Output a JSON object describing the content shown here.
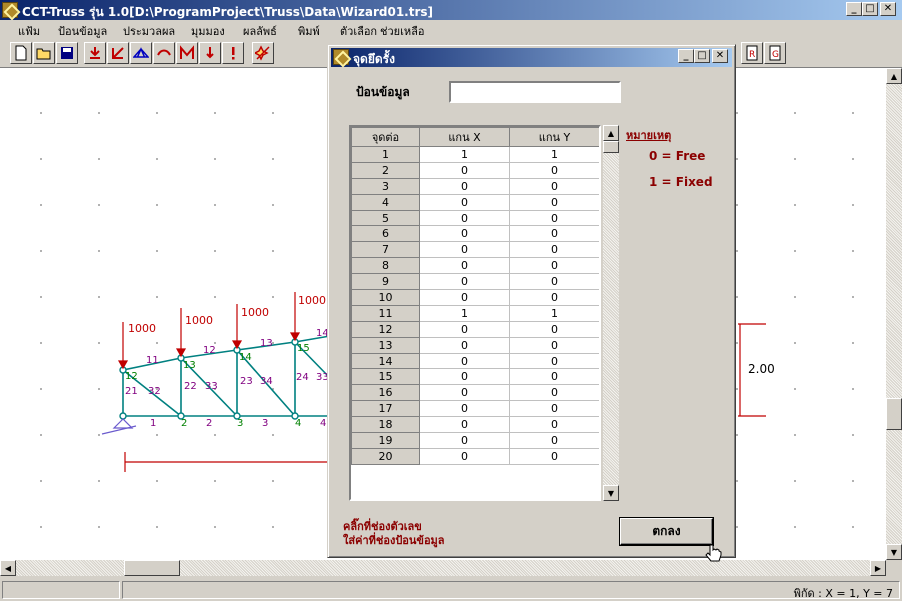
{
  "window": {
    "title": "CCT-Truss รุ่น 1.0[D:\\ProgramProject\\Truss\\Data\\Wizard01.trs]"
  },
  "menu": [
    {
      "label": "แฟ้ม"
    },
    {
      "label": "ป้อนข้อมูล"
    },
    {
      "label": "ประมวลผล"
    },
    {
      "label": "มุมมอง"
    },
    {
      "label": "ผลลัพธ์"
    },
    {
      "label": "พิมพ์"
    },
    {
      "label": "ตัวเลือก"
    },
    {
      "label": "ช่วยเหลือ"
    }
  ],
  "drawing": {
    "loads": [
      "1000",
      "1000",
      "1000",
      "1000"
    ],
    "top_members": [
      "11",
      "12",
      "13"
    ],
    "nodes": [
      "12",
      "13",
      "14",
      "15"
    ],
    "diagonals": [
      "21",
      "32",
      "22",
      "33",
      "23",
      "34",
      "24",
      "33"
    ],
    "bottom_labels": [
      "1",
      "2",
      "2",
      "3",
      "3",
      "4",
      "4"
    ],
    "partial_label": "14",
    "dimension": "2.00"
  },
  "dialog": {
    "title": "จุดยึดรั้ง",
    "input_label": "ป้อนข้อมูล",
    "input_value": "",
    "columns": [
      "จุดต่อ",
      "แกน X",
      "แกน Y"
    ],
    "rows": [
      [
        "1",
        "1",
        "1"
      ],
      [
        "2",
        "0",
        "0"
      ],
      [
        "3",
        "0",
        "0"
      ],
      [
        "4",
        "0",
        "0"
      ],
      [
        "5",
        "0",
        "0"
      ],
      [
        "6",
        "0",
        "0"
      ],
      [
        "7",
        "0",
        "0"
      ],
      [
        "8",
        "0",
        "0"
      ],
      [
        "9",
        "0",
        "0"
      ],
      [
        "10",
        "0",
        "0"
      ],
      [
        "11",
        "1",
        "1"
      ],
      [
        "12",
        "0",
        "0"
      ],
      [
        "13",
        "0",
        "0"
      ],
      [
        "14",
        "0",
        "0"
      ],
      [
        "15",
        "0",
        "0"
      ],
      [
        "16",
        "0",
        "0"
      ],
      [
        "17",
        "0",
        "0"
      ],
      [
        "18",
        "0",
        "0"
      ],
      [
        "19",
        "0",
        "0"
      ],
      [
        "20",
        "0",
        "0"
      ]
    ],
    "note_title": "หมายเหตุ",
    "note_free": "0 = Free",
    "note_fixed": "1 = Fixed",
    "hint_line1": "คลิ๊กที่ช่องตัวเลข",
    "hint_line2": "ใส่ค่าที่ช่องป้อนข้อมูล",
    "ok_label": "ตกลง"
  },
  "status": {
    "coords": "พิกัด : X = 1, Y = 7"
  },
  "colors": {
    "titlebar": "#0a246a",
    "load": "#c00000",
    "member": "#008080",
    "node_label": "#008000",
    "diag_label": "#800080",
    "note": "#8b0000"
  }
}
